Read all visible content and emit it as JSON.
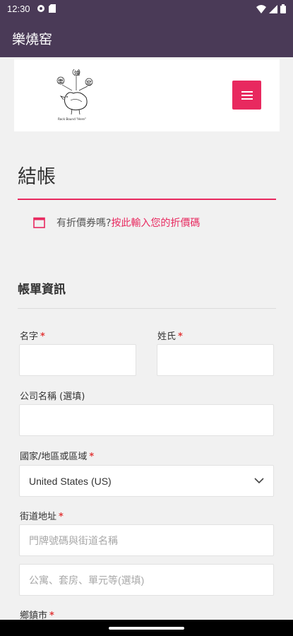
{
  "status_bar": {
    "time": "12:30"
  },
  "app_bar": {
    "title": "樂燒窑"
  },
  "header": {
    "logo_caption": "Rock Bound \"Here\"",
    "logo_icon": "chicken-with-flowers-icon",
    "menu_icon": "hamburger-menu-icon"
  },
  "checkout": {
    "title": "結帳",
    "coupon_prompt": "有折價券嗎?",
    "coupon_link": "按此輸入您的折價碼"
  },
  "billing": {
    "section_title": "帳單資訊",
    "first_name_label": "名字",
    "last_name_label": "姓氏",
    "company_label": "公司名稱 (選填)",
    "country_label": "國家/地區或區域",
    "country_value": "United States (US)",
    "street_label": "街道地址",
    "street_placeholder": "門牌號碼與街道名稱",
    "apartment_placeholder": "公寓、套房、單元等(選填)",
    "city_label": "鄉鎮市",
    "required_mark": "*"
  },
  "colors": {
    "app_bar": "#4a3a57",
    "accent": "#e8295f",
    "required": "#e23b3b"
  }
}
